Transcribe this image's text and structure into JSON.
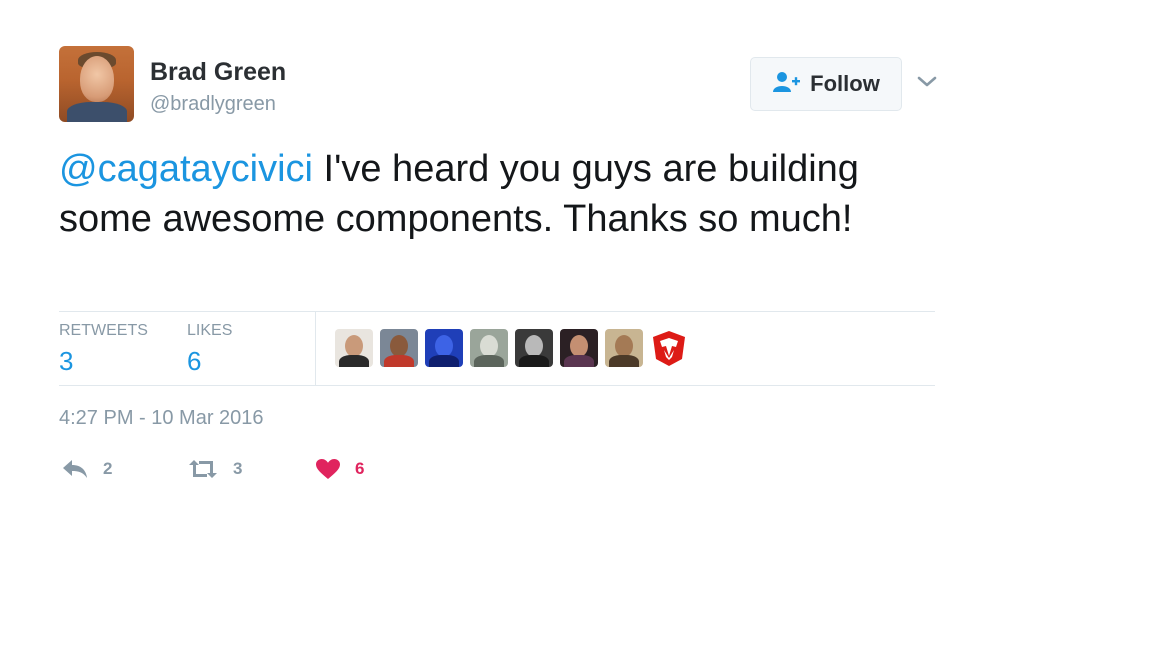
{
  "tweet": {
    "author": {
      "name": "Brad Green",
      "handle": "@bradlygreen"
    },
    "follow_label": "Follow",
    "mention": "@cagataycivici",
    "text": " I've heard you guys are building some awesome components.  Thanks so much!",
    "timestamp": "4:27 PM - 10 Mar 2016"
  },
  "stats": {
    "retweets_label": "RETWEETS",
    "retweets_count": "3",
    "likes_label": "LIKES",
    "likes_count": "6"
  },
  "actions": {
    "reply_count": "2",
    "retweet_count": "3",
    "like_count": "6"
  },
  "colors": {
    "link": "#1b95e0",
    "muted": "#8899a6",
    "like": "#e0245e"
  },
  "icons": [
    "follow-user-icon",
    "chevron-down-icon",
    "reply-icon",
    "retweet-icon",
    "heart-icon"
  ]
}
